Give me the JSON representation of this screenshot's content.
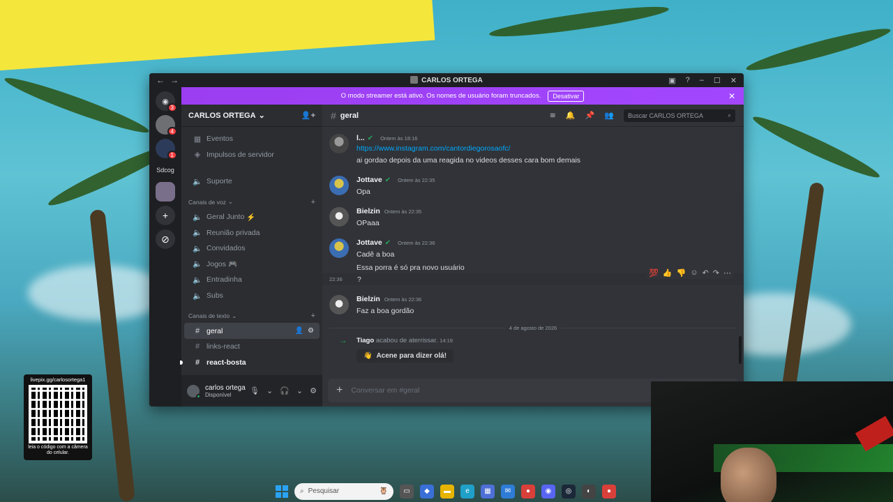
{
  "window": {
    "title": "CARLOS ORTEGA"
  },
  "banner": {
    "text": "O modo streamer está ativo. Os nomes de usuário foram truncados.",
    "button": "Desativar",
    "close": "✕"
  },
  "servers": {
    "home_badge": "3",
    "s1_badge": "4",
    "s2_badge": "1",
    "text_server": "Sdcog"
  },
  "guild": {
    "name": "CARLOS ORTEGA"
  },
  "sidebar": {
    "top_items": [
      {
        "label": "Eventos"
      },
      {
        "label": "Impulsos de servidor"
      },
      {
        "label": "Suporte"
      }
    ],
    "voice_category": "Canais de voz",
    "voice_channels": [
      {
        "label": "Geral Junto",
        "emoji": "⚡"
      },
      {
        "label": "Reunião privada",
        "emoji": ""
      },
      {
        "label": "Convidados",
        "emoji": ""
      },
      {
        "label": "Jogos",
        "emoji": "🎮"
      },
      {
        "label": "Entradinha",
        "emoji": ""
      },
      {
        "label": "Subs",
        "emoji": ""
      }
    ],
    "text_category": "Canais de texto",
    "text_channels": [
      {
        "label": "geral"
      },
      {
        "label": "links-react"
      },
      {
        "label": "react-bosta"
      }
    ]
  },
  "user": {
    "name": "carlos ortega",
    "status": "Disponível"
  },
  "chat": {
    "channel": "geral",
    "search_placeholder": "Buscar CARLOS ORTEGA",
    "composer_placeholder": "Conversar em #geral"
  },
  "messages": [
    {
      "author": "l...",
      "time": "Ontem às 18:16",
      "lines": [
        "https://www.instagram.com/cantordiegorosaofc/",
        "ai gordao depois da uma reagida no videos desses cara bom demais"
      ]
    },
    {
      "author": "Jottave",
      "time": "Ontem às 22:35",
      "lines": [
        "Opa"
      ]
    },
    {
      "author": "Bielzin",
      "time": "Ontem às 22:35",
      "lines": [
        "OPaaa"
      ]
    },
    {
      "author": "Jottave",
      "time": "Ontem às 22:36",
      "lines": [
        "Cadê a boa",
        "Essa porra é só pra novo usuário"
      ],
      "cont_time": "22:36",
      "cont_text": "?"
    },
    {
      "author": "Bielzin",
      "time": "Ontem às 22:36",
      "lines": [
        "Faz a boa gordão"
      ]
    }
  ],
  "date_divider": "4 de agosto de 2026",
  "system": {
    "user": "Tiago",
    "text": "acabou de aterrissar.",
    "time": "14:19",
    "button": "Acene para dizer olá!"
  },
  "qr": {
    "url": "livepix.gg/carlosortega1",
    "hint": "leia o código com a câmera do celular."
  },
  "taskbar": {
    "search": "Pesquisar"
  }
}
